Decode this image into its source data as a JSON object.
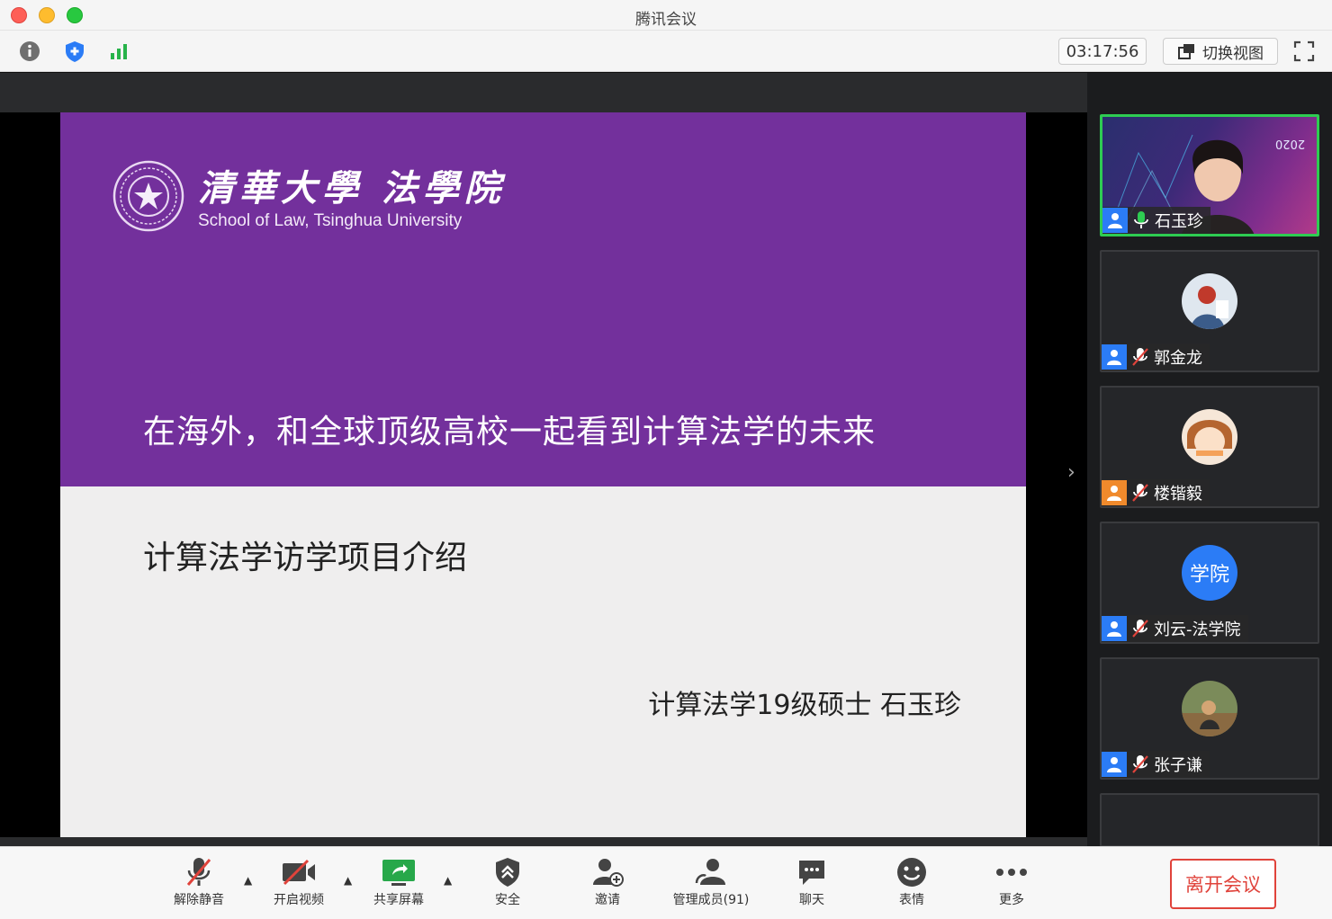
{
  "window": {
    "title": "腾讯会议"
  },
  "topbar": {
    "icons": [
      "info-icon",
      "shield-icon",
      "signal-icon"
    ],
    "meeting_time": "03:17:56",
    "switch_view_label": "切换视图",
    "fullscreen_icon": "fullscreen-icon"
  },
  "slide": {
    "school_name_cn": "清華大學 法學院",
    "school_name_en": "School of Law, Tsinghua University",
    "title": "在海外，和全球顶级高校一起看到计算法学的未来",
    "subtitle": "计算法学访学项目介绍",
    "author": "计算法学19级硕士 石玉珍",
    "band_color": "#73309c"
  },
  "participants": [
    {
      "name": "石玉珍",
      "mic": "active",
      "video": true,
      "icon_color": "blue",
      "tile_badge": "2020"
    },
    {
      "name": "郭金龙",
      "mic": "muted",
      "video": false,
      "icon_color": "blue"
    },
    {
      "name": "楼锴毅",
      "mic": "muted",
      "video": false,
      "icon_color": "orange"
    },
    {
      "name": "刘云-法学院",
      "mic": "muted",
      "video": false,
      "icon_color": "blue",
      "avatar_text": "学院"
    },
    {
      "name": "张子谦",
      "mic": "muted",
      "video": false,
      "icon_color": "blue"
    }
  ],
  "toolbar": {
    "unmute": "解除静音",
    "start_video": "开启视频",
    "share_screen": "共享屏幕",
    "security": "安全",
    "invite": "邀请",
    "manage_members": "管理成员(91)",
    "chat": "聊天",
    "reactions": "表情",
    "more": "更多",
    "leave": "离开会议"
  },
  "colors": {
    "accent_green": "#2ecc52",
    "leave_red": "#e0433b",
    "brand_blue": "#2b7cf6"
  }
}
